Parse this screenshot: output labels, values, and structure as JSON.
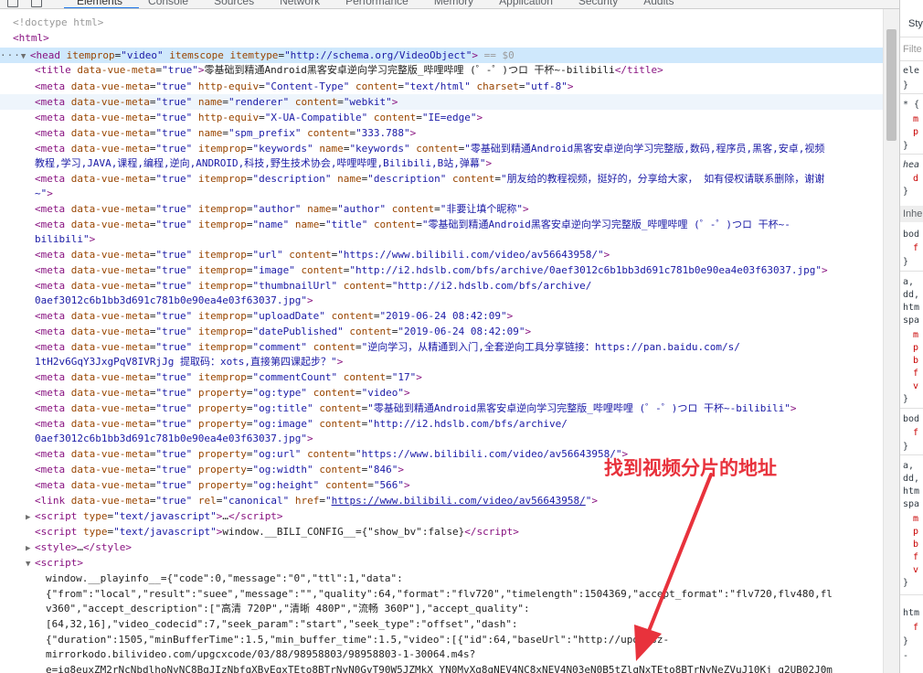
{
  "toolbar": {
    "tabs": [
      "Elements",
      "Console",
      "Sources",
      "Network",
      "Performance",
      "Memory",
      "Application",
      "Security",
      "Audits"
    ]
  },
  "dom": {
    "doctype": "<!doctype html>",
    "html_open": "<html>",
    "head_tag": "<head",
    "head_attrs": [
      {
        "name": "itemprop",
        "value": "\"video\""
      },
      {
        "name": "itemscope",
        "value": ""
      },
      {
        "name": "itemtype",
        "value": "\"http://schema.org/VideoObject\""
      }
    ],
    "head_close": ">",
    "selected_marker": " == $0",
    "title_line": {
      "open": "<title",
      "attr": "data-vue-meta",
      "attr_val": "\"true\"",
      "close": ">",
      "text": "零基础到精通Android黑客安卓逆向学习完整版_哔哩哔哩 (゜-゜)つロ 干杯~-bilibili",
      "end": "</title>"
    },
    "metas": [
      {
        "a1": "http-equiv",
        "v1": "\"Content-Type\"",
        "a2": "content",
        "v2": "\"text/html\"",
        "a3": "charset",
        "v3": "\"utf-8\""
      },
      {
        "a1": "name",
        "v1": "\"renderer\"",
        "a2": "content",
        "v2": "\"webkit\""
      },
      {
        "a1": "http-equiv",
        "v1": "\"X-UA-Compatible\"",
        "a2": "content",
        "v2": "\"IE=edge\""
      },
      {
        "a1": "name",
        "v1": "\"spm_prefix\"",
        "a2": "content",
        "v2": "\"333.788\""
      }
    ],
    "keywords": {
      "l1": "\"零基础到精通Android黑客安卓逆向学习完整版,数码,程序员,黑客,安卓,视频",
      "l2": "教程,学习,JAVA,课程,编程,逆向,ANDROID,科技,野生技术协会,哔哩哔哩,Bilibili,B站,弹幕\""
    },
    "description": {
      "l1": "\"朋友给的教程视频，挺好的，分享给大家， 如有侵权请联系删除，谢谢",
      "l2": "~\""
    },
    "author_value": "\"非要让填个昵称\"",
    "name_title": {
      "l1": "\"零基础到精通Android黑客安卓逆向学习完整版_哔哩哔哩 (゜-゜)つロ 干杯~-",
      "l2": "bilibili\""
    },
    "url_value": "\"https://www.bilibili.com/video/av56643958/\"",
    "image_value": "\"http://i2.hdslb.com/bfs/archive/0aef3012c6b1bb3d691c781b0e90ea4e03f63037.jpg\"",
    "thumbnail": {
      "l1": "\"http://i2.hdslb.com/bfs/archive/",
      "l2": "0aef3012c6b1bb3d691c781b0e90ea4e03f63037.jpg\""
    },
    "upload_date": "\"2019-06-24 08:42:09\"",
    "date_published": "\"2019-06-24 08:42:09\"",
    "comment": {
      "l1": "\"逆向学习，从精通到入门,全套逆向工具分享链接：https://pan.baidu.com/s/",
      "l2": "1tH2v6GqY3JxgPqV8IVRjJg 提取码：xots,直接第四课起步？\""
    },
    "comment_count": "\"17\"",
    "og_type": "\"video\"",
    "og_title": "\"零基础到精通Android黑客安卓逆向学习完整版_哔哩哔哩 (゜-゜)つロ 干杯~-bilibili\"",
    "og_image": {
      "l1": "\"http://i2.hdslb.com/bfs/archive/",
      "l2": "0aef3012c6b1bb3d691c781b0e90ea4e03f63037.jpg\""
    },
    "og_url": "\"https://www.bilibili.com/video/av56643958/\"",
    "og_width": "\"846\"",
    "og_height": "\"566\"",
    "canonical_href": "https://www.bilibili.com/video/av56643958/",
    "script1_type": "\"text/javascript\"",
    "script2_type": "\"text/javascript\"",
    "script2_text": "window.__BILI_CONFIG__={\"show_bv\":false}",
    "script_tag_open": "<script>",
    "playinfo": [
      "window.__playinfo__={\"code\":0,\"message\":\"0\",\"ttl\":1,\"data\":",
      "{\"from\":\"local\",\"result\":\"suee\",\"message\":\"\",\"quality\":64,\"format\":\"flv720\",\"timelength\":1504369,\"accept_format\":\"flv720,flv480,fl",
      "v360\",\"accept_description\":[\"高清 720P\",\"清晰 480P\",\"流畅 360P\"],\"accept_quality\":",
      "[64,32,16],\"video_codecid\":7,\"seek_param\":\"start\",\"seek_type\":\"offset\",\"dash\":",
      "{\"duration\":1505,\"minBufferTime\":1.5,\"min_buffer_time\":1.5,\"video\":[{\"id\":64,\"baseUrl\":\"http://upos-sz-",
      "mirrorkodo.bilivideo.com/upgcxcode/03/88/98958803/98958803-1-30064.m4s?",
      "e=ig8euxZM2rNcNbdlhoNvNC8BqJIzNbfqXBvEqxTEto8BTrNvN0GvT90W5JZMkX_YN0MvXg8gNEV4NC8xNEV4N03eN0B5tZlqNxTEto8BTrNvNeZVuJ10Kj_g2UB02J0m"
    ]
  },
  "annotation": {
    "text": "找到视频分片的地址",
    "color": "#e8323c"
  },
  "styles_pane": {
    "tab": "Sty",
    "filter": "Filte",
    "inherited_label": "Inhe",
    "snippets": [
      "ele",
      "}",
      "* {",
      "m",
      "p",
      "}",
      "hea",
      "d",
      "}",
      "bod",
      "f",
      "}",
      "a,",
      "dd,",
      "htm",
      "spa",
      "m",
      "p",
      "b",
      "f",
      "v",
      "}",
      "bod",
      "f",
      "}",
      "a,",
      "dd,",
      "htm",
      "spa",
      "m",
      "p",
      "b",
      "f",
      "v",
      "}",
      "htm",
      "f",
      "}",
      "-"
    ]
  },
  "colors": {
    "tag": "#881280",
    "attr_name": "#994500",
    "attr_value": "#1a1aa6",
    "selection": "#cfe8fc"
  }
}
